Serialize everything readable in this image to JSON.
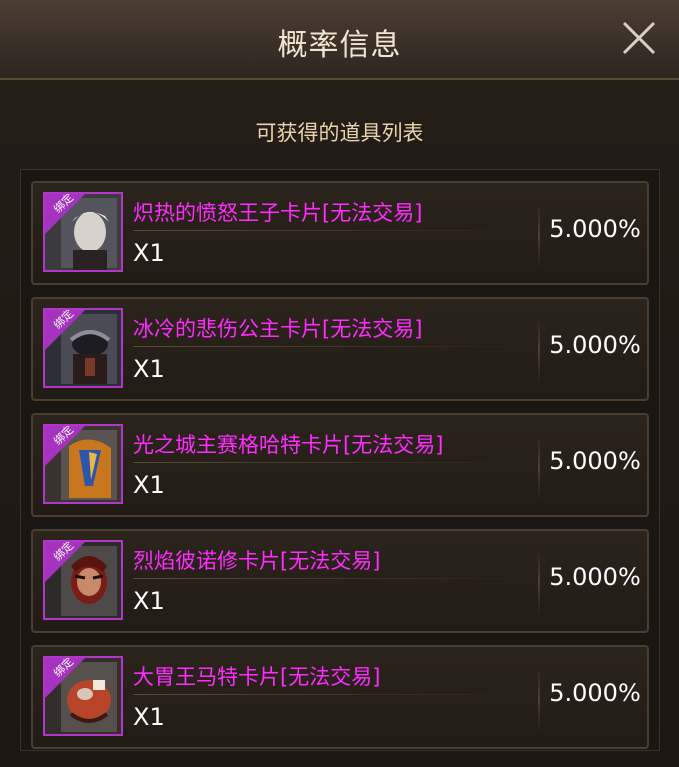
{
  "dialog": {
    "title": "概率信息",
    "subtitle": "可获得的道具列表",
    "close_icon": "close-icon"
  },
  "items": [
    {
      "name": "炽热的愤怒王子卡片[无法交易]",
      "qty": "X1",
      "rate": "5.000%",
      "badge": "绑定",
      "icon": "card-prince-icon"
    },
    {
      "name": "冰冷的悲伤公主卡片[无法交易]",
      "qty": "X1",
      "rate": "5.000%",
      "badge": "绑定",
      "icon": "card-princess-icon"
    },
    {
      "name": "光之城主赛格哈特卡片[无法交易]",
      "qty": "X1",
      "rate": "5.000%",
      "badge": "绑定",
      "icon": "card-lord-icon"
    },
    {
      "name": "烈焰彼诺修卡片[无法交易]",
      "qty": "X1",
      "rate": "5.000%",
      "badge": "绑定",
      "icon": "card-flame-icon"
    },
    {
      "name": "大胃王马特卡片[无法交易]",
      "qty": "X1",
      "rate": "5.000%",
      "badge": "绑定",
      "icon": "card-glutton-icon"
    }
  ],
  "colors": {
    "item_name": "#ff2bff",
    "frame": "#b136c9",
    "title": "#f1e6d2",
    "subtitle": "#e9d4ae"
  }
}
